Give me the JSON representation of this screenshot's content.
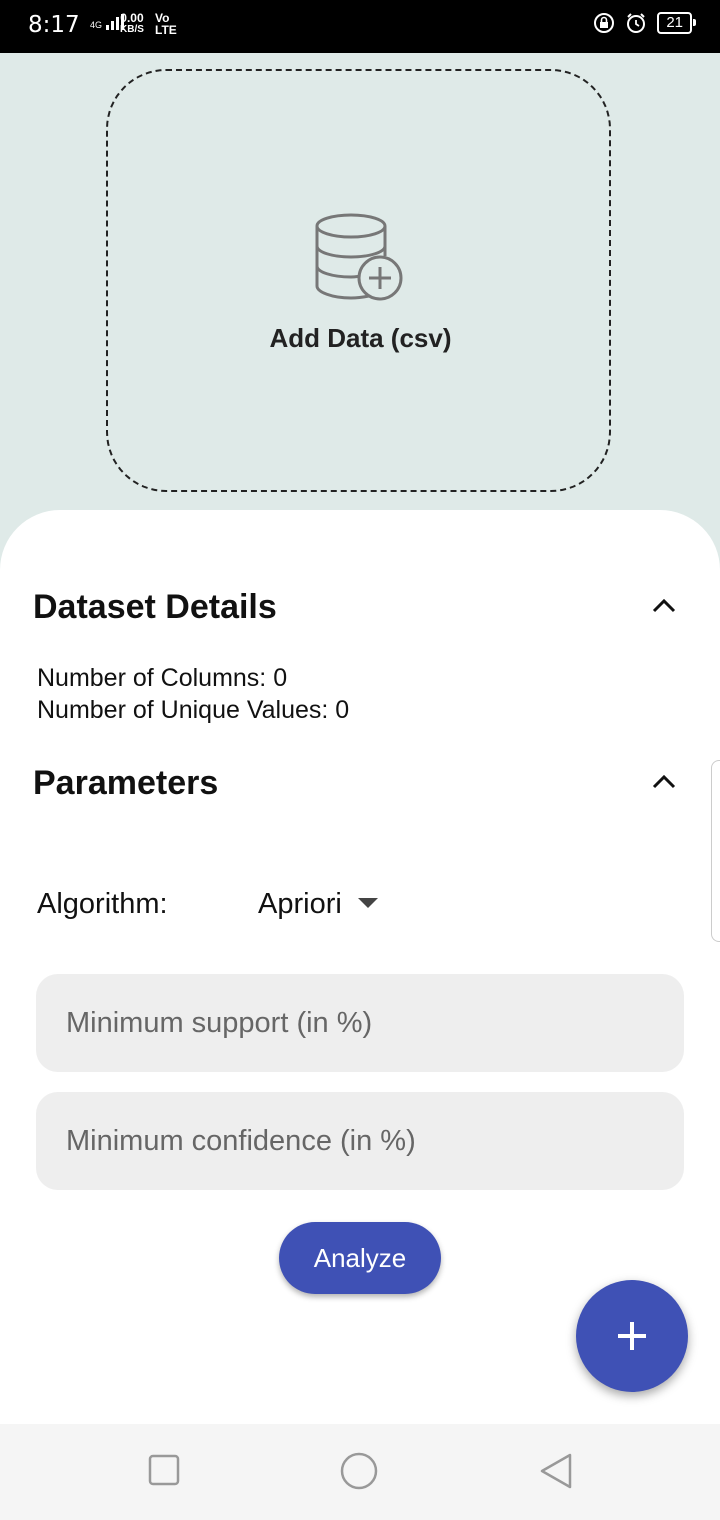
{
  "status_bar": {
    "time": "8:17",
    "network": "4G",
    "speed_value": "0.00",
    "speed_unit": "KB/S",
    "volte_top": "Vo",
    "volte_bottom": "LTE",
    "battery": "21"
  },
  "upload": {
    "icon": "database-add-icon",
    "label": "Add Data (csv)"
  },
  "dataset_details": {
    "title": "Dataset Details",
    "columns_line": "Number of Columns: 0",
    "unique_values_line": "Number of Unique Values: 0"
  },
  "parameters": {
    "title": "Parameters",
    "algorithm_label": "Algorithm:",
    "algorithm_value": "Apriori",
    "min_support_placeholder": "Minimum support (in %)",
    "min_confidence_placeholder": "Minimum confidence (in %)",
    "analyze_label": "Analyze"
  },
  "colors": {
    "accent": "#3f51b5",
    "background": "#dfeae8",
    "field": "#eeeeee"
  },
  "nav_bar": {
    "icons": [
      "square-icon",
      "circle-icon",
      "triangle-back-icon"
    ]
  }
}
